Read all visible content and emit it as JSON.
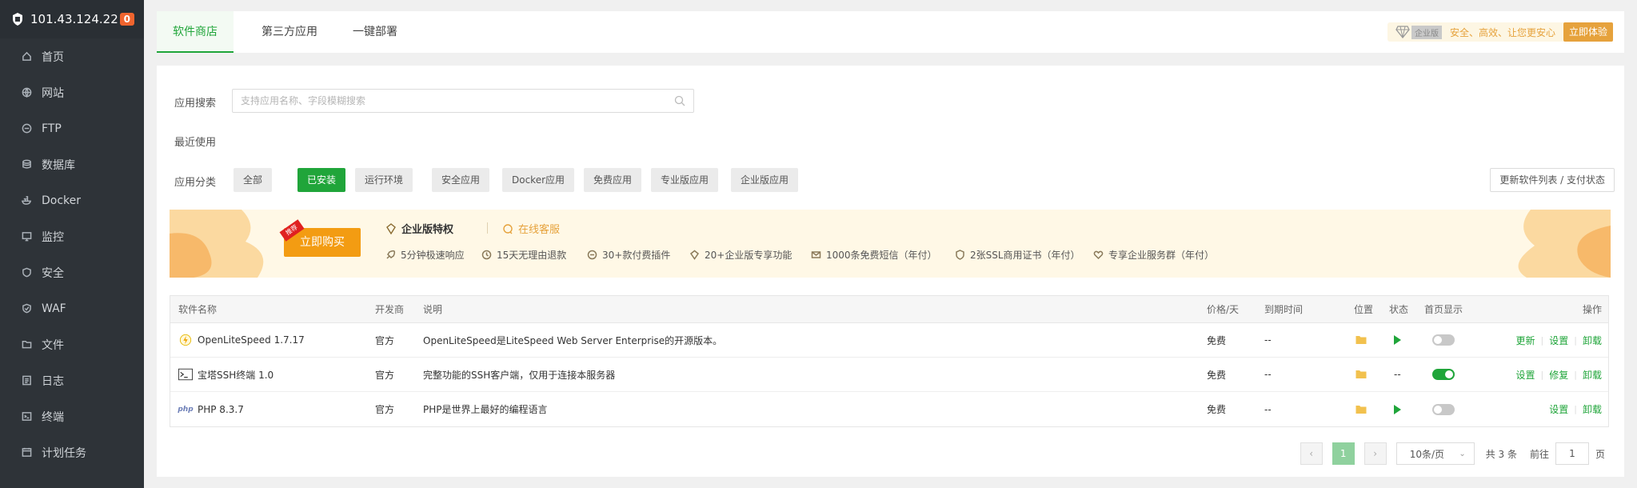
{
  "sidebar": {
    "ip": "101.43.124.22",
    "badge": "0",
    "items": [
      {
        "label": "首页",
        "icon": "home-icon"
      },
      {
        "label": "网站",
        "icon": "globe-icon"
      },
      {
        "label": "FTP",
        "icon": "ftp-icon"
      },
      {
        "label": "数据库",
        "icon": "database-icon"
      },
      {
        "label": "Docker",
        "icon": "docker-icon"
      },
      {
        "label": "监控",
        "icon": "monitor-icon"
      },
      {
        "label": "安全",
        "icon": "shield-icon"
      },
      {
        "label": "WAF",
        "icon": "waf-icon"
      },
      {
        "label": "文件",
        "icon": "folder-icon"
      },
      {
        "label": "日志",
        "icon": "log-icon"
      },
      {
        "label": "终端",
        "icon": "terminal-icon"
      },
      {
        "label": "计划任务",
        "icon": "clock-icon"
      }
    ]
  },
  "tabs": [
    "软件商店",
    "第三方应用",
    "一键部署"
  ],
  "enterprise": {
    "tag": "企业版",
    "slogan": "安全、高效、让您更安心",
    "button": "立即体验"
  },
  "search": {
    "label": "应用搜索",
    "placeholder": "支持应用名称、字段模糊搜索"
  },
  "recent_label": "最近使用",
  "category": {
    "label": "应用分类",
    "items": [
      "全部",
      "已安装",
      "运行环境",
      "安全应用",
      "Docker应用",
      "免费应用",
      "专业版应用",
      "企业版应用"
    ],
    "active_index": 1
  },
  "update_button": "更新软件列表 / 支付状态",
  "promo": {
    "ribbon": "推荐",
    "buy": "立即购买",
    "title": "企业版特权",
    "service": "在线客服",
    "features": [
      "5分钟极速响应",
      "15天无理由退款",
      "30+款付费插件",
      "20+企业版专享功能",
      "1000条免费短信（年付）",
      "2张SSL商用证书（年付）",
      "专享企业服务群（年付）"
    ]
  },
  "table": {
    "headers": {
      "name": "软件名称",
      "dev": "开发商",
      "desc": "说明",
      "price": "价格/天",
      "expire": "到期时间",
      "location": "位置",
      "status": "状态",
      "home": "首页显示",
      "ops": "操作"
    },
    "rows": [
      {
        "name": "OpenLiteSpeed 1.7.17",
        "icon": "openlitespeed-icon",
        "dev": "官方",
        "desc": "OpenLiteSpeed是LiteSpeed Web Server Enterprise的开源版本。",
        "price": "免费",
        "expire": "--",
        "status": "play",
        "home_on": false,
        "ops": [
          "更新",
          "设置",
          "卸载"
        ]
      },
      {
        "name": "宝塔SSH终端 1.0",
        "icon": "terminal-icon",
        "dev": "官方",
        "desc": "完整功能的SSH客户端，仅用于连接本服务器",
        "price": "免费",
        "expire": "--",
        "status": "--",
        "home_on": true,
        "ops": [
          "设置",
          "修复",
          "卸载"
        ]
      },
      {
        "name": "PHP 8.3.7",
        "icon": "php-icon",
        "dev": "官方",
        "desc": "PHP是世界上最好的编程语言",
        "price": "免费",
        "expire": "--",
        "status": "play",
        "home_on": false,
        "ops": [
          "设置",
          "卸载"
        ]
      }
    ]
  },
  "pager": {
    "current": "1",
    "page_size": "10条/页",
    "total": "共 3 条",
    "goto_prefix": "前往",
    "goto_value": "1",
    "goto_suffix": "页"
  },
  "colors": {
    "accent": "#20a53a",
    "sidebar_bg": "#2e3338",
    "enterprise": "#e6a23c",
    "badge": "#f0642e"
  }
}
